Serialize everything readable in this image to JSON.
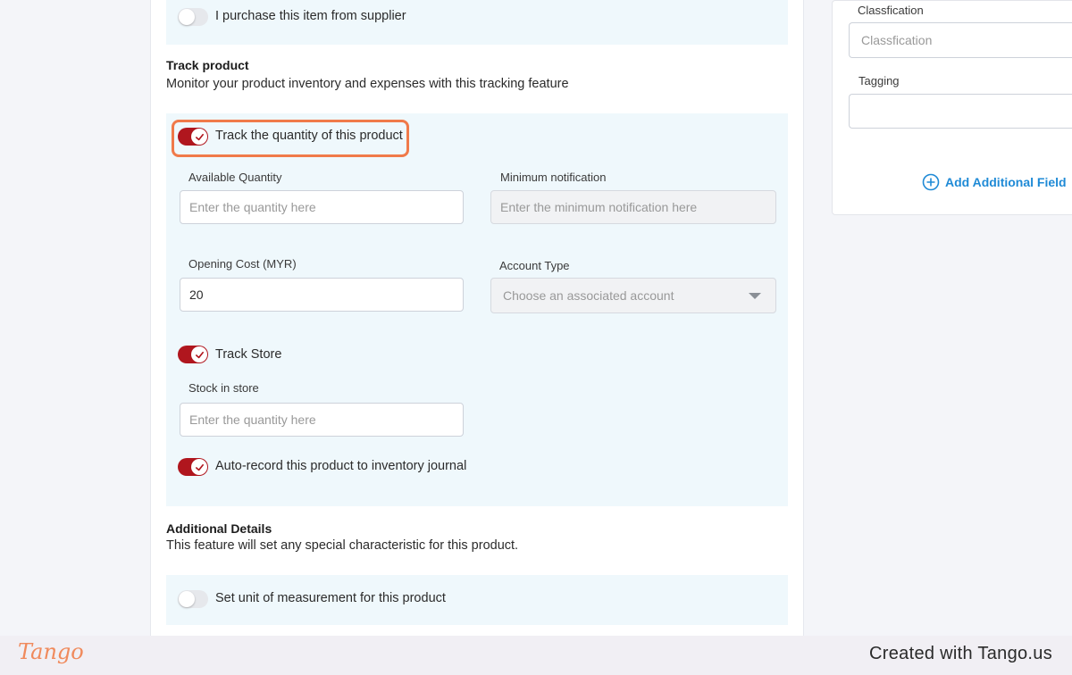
{
  "supplier": {
    "label": "I purchase this item from supplier"
  },
  "track_product": {
    "heading": "Track product",
    "description": "Monitor your product inventory and expenses with this tracking feature",
    "track_quantity_label": "Track the quantity of this product",
    "available_quantity": {
      "label": "Available Quantity",
      "placeholder": "Enter the quantity here"
    },
    "minimum_notification": {
      "label": "Minimum notification",
      "placeholder": "Enter the minimum notification here"
    },
    "opening_cost": {
      "label": "Opening Cost (MYR)",
      "value": "20"
    },
    "account_type": {
      "label": "Account Type",
      "placeholder": "Choose an associated account"
    },
    "track_store_label": "Track Store",
    "stock_in_store": {
      "label": "Stock in store",
      "placeholder": "Enter the quantity here"
    },
    "auto_record_label": "Auto-record this product to inventory journal"
  },
  "additional_details": {
    "heading": "Additional Details",
    "description": "This feature will set any special characteristic for this product.",
    "unit_label": "Set unit of measurement for this product"
  },
  "side": {
    "classification": {
      "label": "Classfication",
      "placeholder": "Classfication"
    },
    "tagging": {
      "label": "Tagging",
      "value": ""
    },
    "add_field_label": "Add Additional Field"
  },
  "footer": {
    "logo": "Tango",
    "created": "Created with Tango.us"
  },
  "colors": {
    "toggle_on": "#b0161e",
    "highlight": "#f07a4a",
    "link": "#1f8ad6",
    "panel": "#eff8fc"
  },
  "icons": {
    "check": "check-icon",
    "dropdown": "chevron-down-icon",
    "add": "plus-circle-icon"
  }
}
